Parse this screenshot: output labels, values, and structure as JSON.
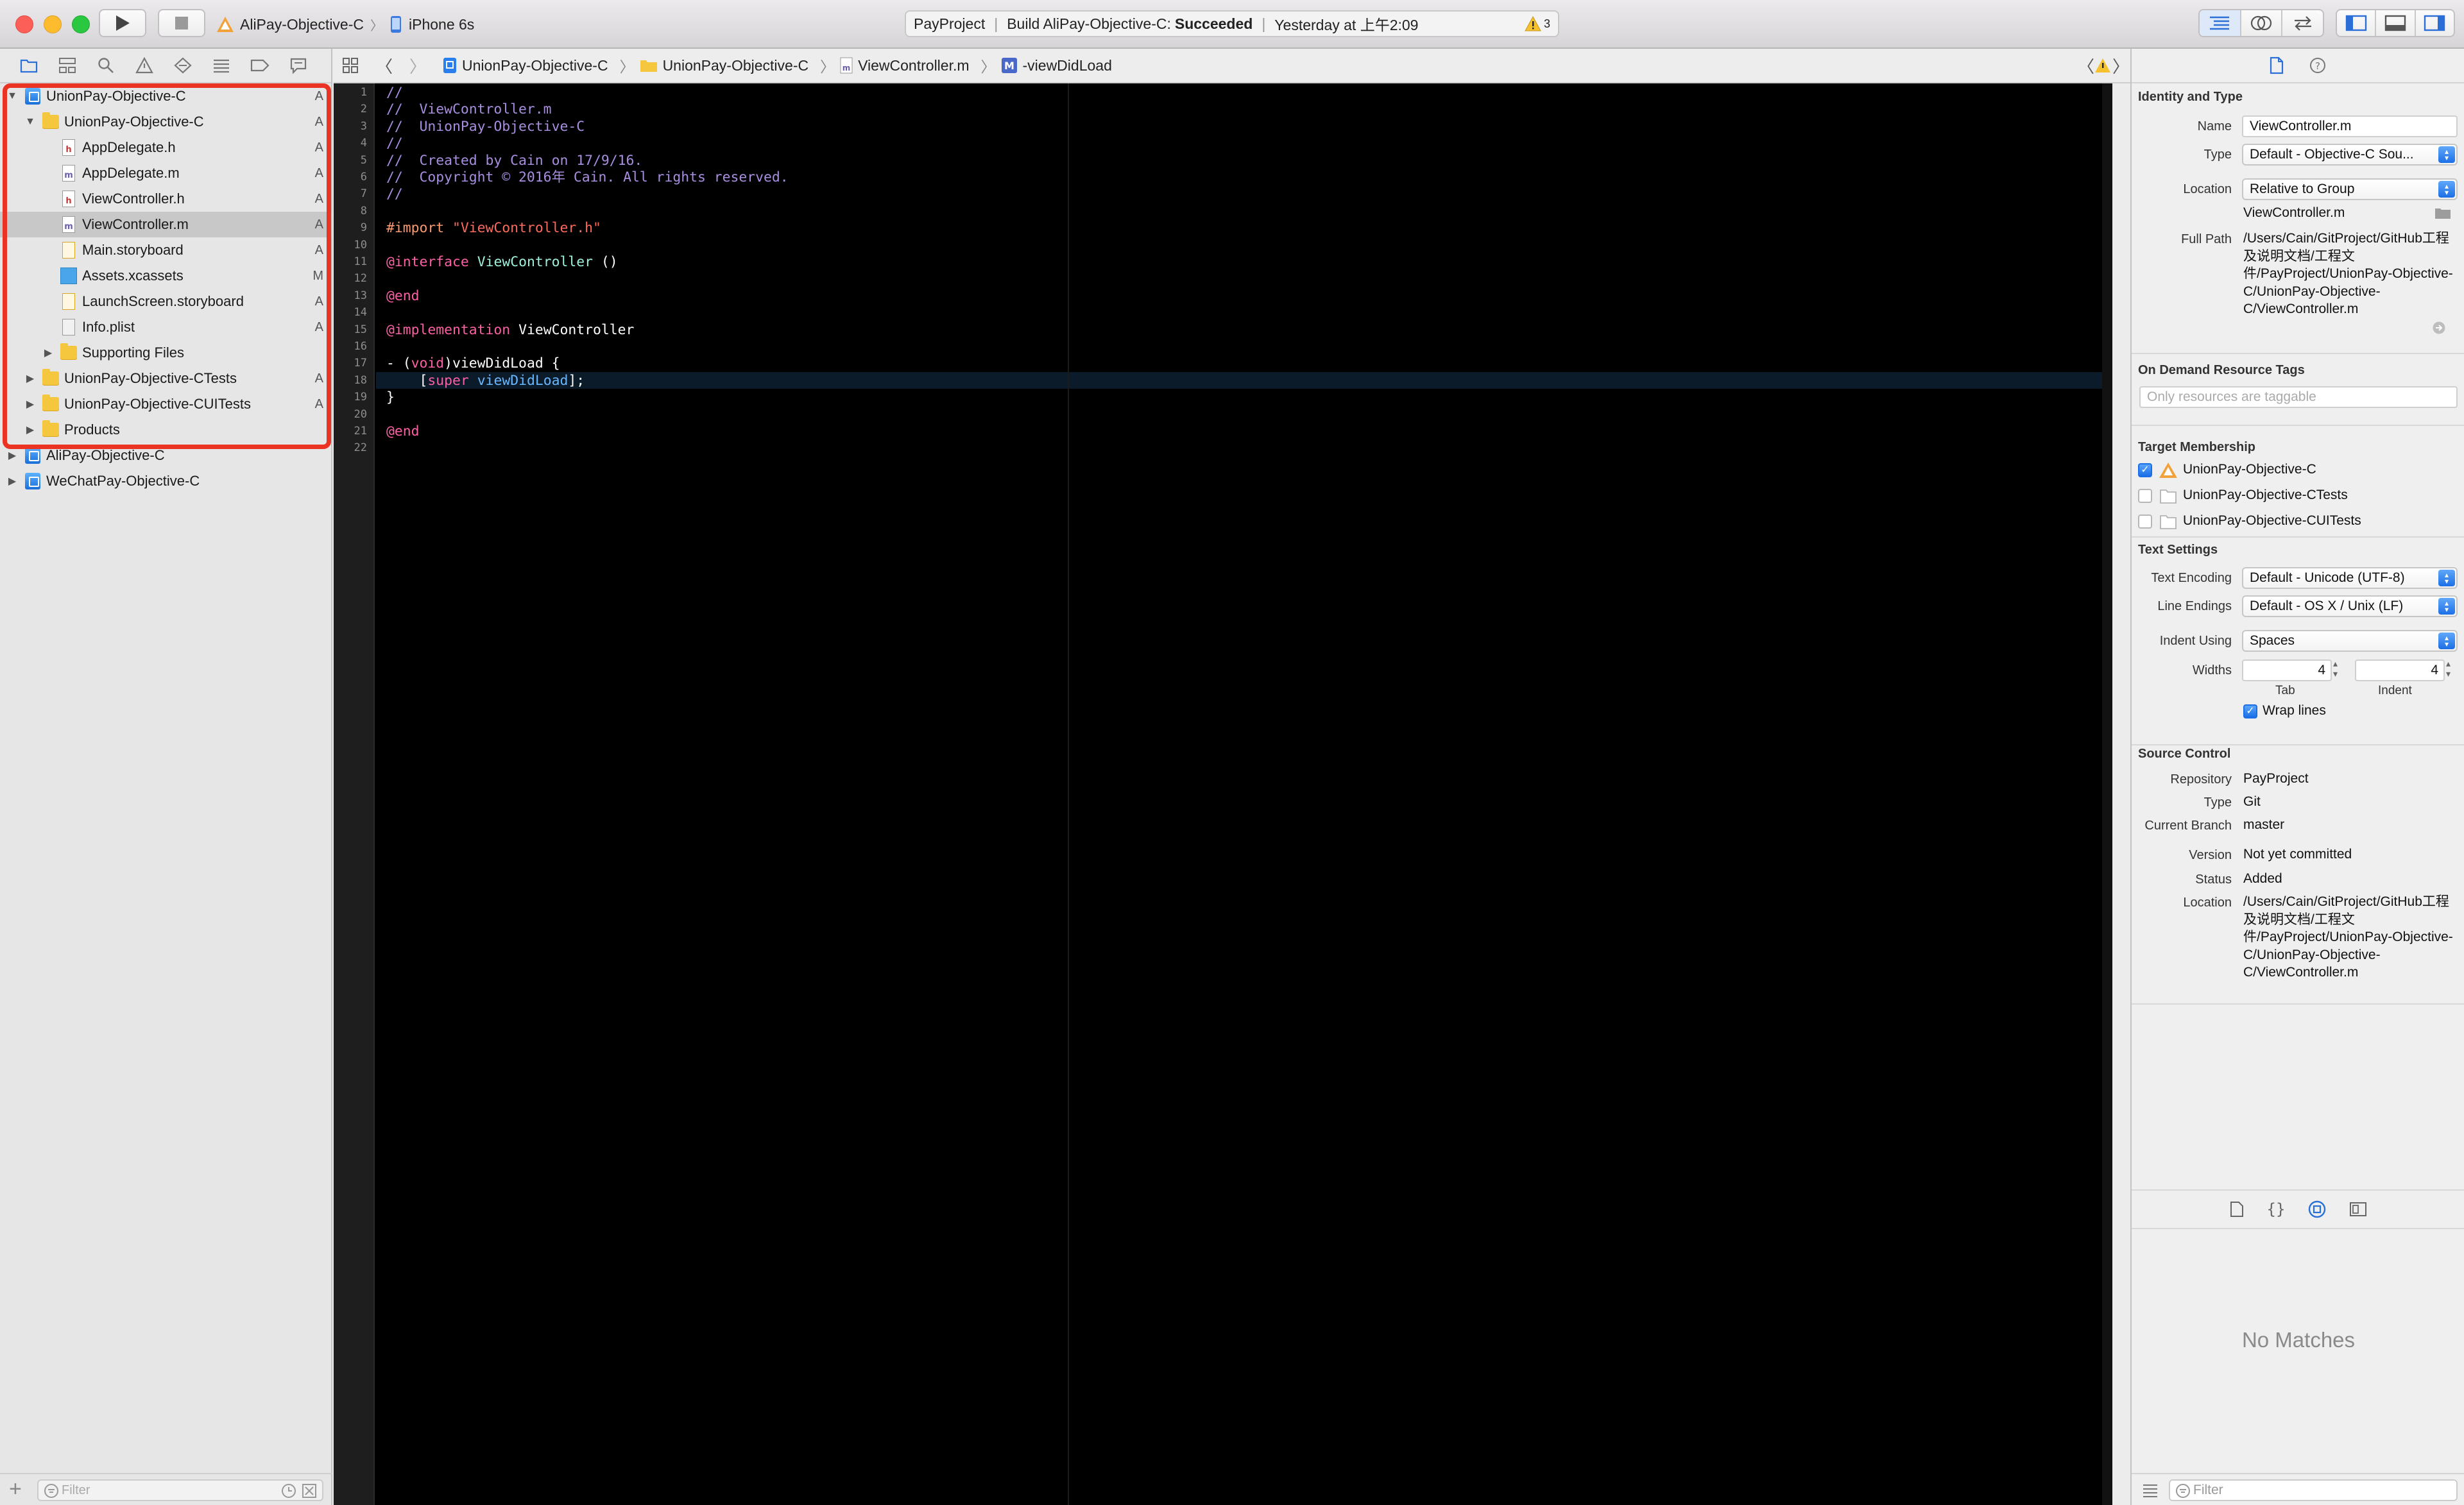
{
  "toolbar": {
    "scheme_target": "AliPay-Objective-C",
    "device": "iPhone 6s",
    "activity": {
      "project": "PayProject",
      "build_prefix": "Build AliPay-Objective-C:",
      "build_status": "Succeeded",
      "time": "Yesterday at 上午2:09",
      "warning_count": "3"
    }
  },
  "navigator": {
    "filter_placeholder": "Filter",
    "items": [
      {
        "label": "UnionPay-Objective-C",
        "status": "A",
        "icon": "project-icon",
        "disclosure": "open"
      },
      {
        "label": "UnionPay-Objective-C",
        "status": "A",
        "icon": "folder-icon",
        "disclosure": "open"
      },
      {
        "label": "AppDelegate.h",
        "status": "A",
        "icon": "header-file-icon",
        "letter": "h"
      },
      {
        "label": "AppDelegate.m",
        "status": "A",
        "icon": "source-file-icon",
        "letter": "m"
      },
      {
        "label": "ViewController.h",
        "status": "A",
        "icon": "header-file-icon",
        "letter": "h"
      },
      {
        "label": "ViewController.m",
        "status": "A",
        "icon": "source-file-icon",
        "letter": "m",
        "selected": true
      },
      {
        "label": "Main.storyboard",
        "status": "A",
        "icon": "storyboard-icon"
      },
      {
        "label": "Assets.xcassets",
        "status": "M",
        "icon": "assets-icon"
      },
      {
        "label": "LaunchScreen.storyboard",
        "status": "A",
        "icon": "storyboard-icon"
      },
      {
        "label": "Info.plist",
        "status": "A",
        "icon": "plist-icon"
      },
      {
        "label": "Supporting Files",
        "status": "",
        "icon": "folder-icon",
        "disclosure": "closed"
      },
      {
        "label": "UnionPay-Objective-CTests",
        "status": "A",
        "icon": "folder-icon",
        "disclosure": "closed"
      },
      {
        "label": "UnionPay-Objective-CUITests",
        "status": "A",
        "icon": "folder-icon",
        "disclosure": "closed"
      },
      {
        "label": "Products",
        "status": "",
        "icon": "folder-icon",
        "disclosure": "closed"
      },
      {
        "label": "AliPay-Objective-C",
        "status": "",
        "icon": "project-icon",
        "disclosure": "closed"
      },
      {
        "label": "WeChatPay-Objective-C",
        "status": "",
        "icon": "project-icon",
        "disclosure": "closed"
      }
    ]
  },
  "jumpbar": {
    "crumbs": [
      "UnionPay-Objective-C",
      "UnionPay-Objective-C",
      "ViewController.m",
      "-viewDidLoad"
    ]
  },
  "editor": {
    "line_numbers": [
      "1",
      "2",
      "3",
      "4",
      "5",
      "6",
      "7",
      "8",
      "9",
      "10",
      "11",
      "12",
      "13",
      "14",
      "15",
      "16",
      "17",
      "18",
      "19",
      "20",
      "21",
      "22"
    ],
    "code_lines": [
      "//",
      "//  ViewController.m",
      "//  UnionPay-Objective-C",
      "//",
      "//  Created by Cain on 17/9/16.",
      "//  Copyright © 2016年 Cain. All rights reserved.",
      "//",
      "",
      "#import \"ViewController.h\"",
      "",
      "@interface ViewController ()",
      "",
      "@end",
      "",
      "@implementation ViewController",
      "",
      "- (void)viewDidLoad {",
      "    [super viewDidLoad];",
      "}",
      "",
      "@end",
      ""
    ]
  },
  "inspector": {
    "identity": {
      "title": "Identity and Type",
      "name_label": "Name",
      "name_value": "ViewController.m",
      "type_label": "Type",
      "type_value": "Default - Objective-C Sou...",
      "location_label": "Location",
      "location_value": "Relative to Group",
      "location_file": "ViewController.m",
      "fullpath_label": "Full Path",
      "fullpath_value": "/Users/Cain/GitProject/GitHub工程及说明文档/工程文件/PayProject/UnionPay-Objective-C/UnionPay-Objective-C/ViewController.m"
    },
    "on_demand": {
      "title": "On Demand Resource Tags",
      "placeholder": "Only resources are taggable"
    },
    "target_membership": {
      "title": "Target Membership",
      "targets": [
        {
          "label": "UnionPay-Objective-C",
          "checked": true
        },
        {
          "label": "UnionPay-Objective-CTests",
          "checked": false
        },
        {
          "label": "UnionPay-Objective-CUITests",
          "checked": false
        }
      ]
    },
    "text_settings": {
      "title": "Text Settings",
      "encoding_label": "Text Encoding",
      "encoding_value": "Default - Unicode (UTF-8)",
      "line_endings_label": "Line Endings",
      "line_endings_value": "Default - OS X / Unix (LF)",
      "indent_using_label": "Indent Using",
      "indent_using_value": "Spaces",
      "widths_label": "Widths",
      "tab_value": "4",
      "indent_value": "4",
      "tab_label": "Tab",
      "indent_label": "Indent",
      "wrap_lines_label": "Wrap lines",
      "wrap_lines_checked": true
    },
    "source_control": {
      "title": "Source Control",
      "repository_label": "Repository",
      "repository_value": "PayProject",
      "type_label": "Type",
      "type_value": "Git",
      "branch_label": "Current Branch",
      "branch_value": "master",
      "version_label": "Version",
      "version_value": "Not yet committed",
      "status_label": "Status",
      "status_value": "Added",
      "location_label": "Location",
      "location_value": "/Users/Cain/GitProject/GitHub工程及说明文档/工程文件/PayProject/UnionPay-Objective-C/UnionPay-Objective-C/ViewController.m"
    },
    "library": {
      "no_matches": "No Matches",
      "filter_placeholder": "Filter"
    }
  },
  "colors": {
    "accent": "#1b6ee6",
    "highlight_box": "#ea3323",
    "editor_bg": "#000000",
    "comment": "#a88ee0",
    "keyword": "#fc5fa3",
    "string": "#fc6a5d",
    "preprocessor": "#fc9a6d",
    "class_name": "#9ef1dd",
    "method": "#67b7ff"
  }
}
